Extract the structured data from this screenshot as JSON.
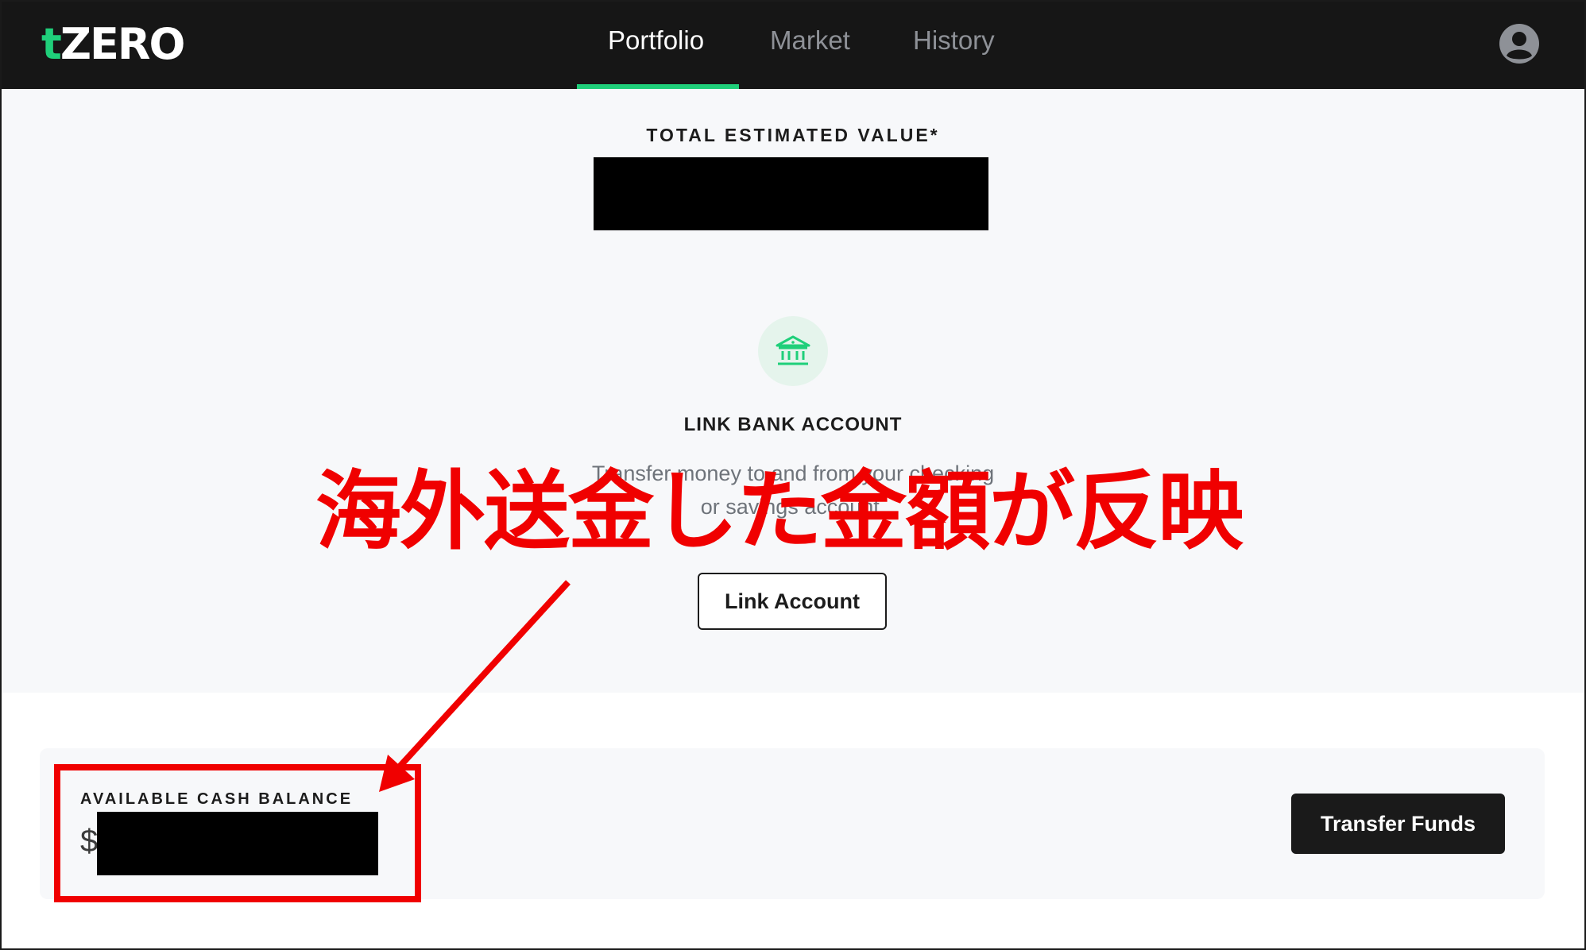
{
  "header": {
    "logo_accent": "t",
    "logo_text": "ZERO",
    "tabs": [
      {
        "label": "Portfolio",
        "active": true
      },
      {
        "label": "Market",
        "active": false
      },
      {
        "label": "History",
        "active": false
      }
    ],
    "user_icon": "user-circle-icon",
    "accent_color": "#1fcf7a"
  },
  "portfolio": {
    "total_label": "TOTAL ESTIMATED VALUE*",
    "bank_icon": "bank-icon",
    "link_bank_title": "LINK BANK ACCOUNT",
    "link_bank_desc_line1": "Transfer money to and from your checking",
    "link_bank_desc_line2": "or savings account.",
    "link_account_button": "Link Account"
  },
  "balance": {
    "label": "AVAILABLE CASH BALANCE",
    "currency_symbol": "$",
    "transfer_button": "Transfer Funds"
  },
  "annotation": {
    "text": "海外送金した金額が反映",
    "color": "#f00000"
  }
}
